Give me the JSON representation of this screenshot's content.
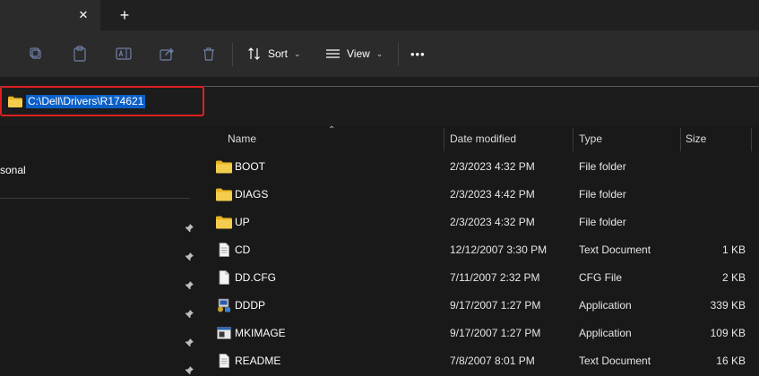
{
  "tabbar": {
    "close_symbol": "✕",
    "new_tab_symbol": "+"
  },
  "toolbar": {
    "sort_label": "Sort",
    "view_label": "View",
    "more_label": "•••",
    "icons": [
      "copy-icon",
      "paste-icon",
      "rename-icon",
      "share-icon",
      "delete-icon"
    ]
  },
  "address": {
    "path": "C:\\Dell\\Drivers\\R174621"
  },
  "nav": {
    "personal_label": "sonal"
  },
  "columns": {
    "name": "Name",
    "date": "Date modified",
    "type": "Type",
    "size": "Size"
  },
  "files": [
    {
      "name": "BOOT",
      "date": "2/3/2023 4:32 PM",
      "type": "File folder",
      "size": "",
      "icon": "folder-icon"
    },
    {
      "name": "DIAGS",
      "date": "2/3/2023 4:42 PM",
      "type": "File folder",
      "size": "",
      "icon": "folder-icon"
    },
    {
      "name": "UP",
      "date": "2/3/2023 4:32 PM",
      "type": "File folder",
      "size": "",
      "icon": "folder-icon"
    },
    {
      "name": "CD",
      "date": "12/12/2007 3:30 PM",
      "type": "Text Document",
      "size": "1 KB",
      "icon": "text-file-icon"
    },
    {
      "name": "DD.CFG",
      "date": "7/11/2007 2:32 PM",
      "type": "CFG File",
      "size": "2 KB",
      "icon": "file-icon"
    },
    {
      "name": "DDDP",
      "date": "9/17/2007 1:27 PM",
      "type": "Application",
      "size": "339 KB",
      "icon": "application-icon"
    },
    {
      "name": "MKIMAGE",
      "date": "9/17/2007 1:27 PM",
      "type": "Application",
      "size": "109 KB",
      "icon": "window-app-icon"
    },
    {
      "name": "README",
      "date": "7/8/2007 8:01 PM",
      "type": "Text Document",
      "size": "16 KB",
      "icon": "text-file-icon"
    }
  ],
  "colors": {
    "selection": "#0a5fc8",
    "highlight_border": "#e02020",
    "folder": "#f2c94c"
  }
}
